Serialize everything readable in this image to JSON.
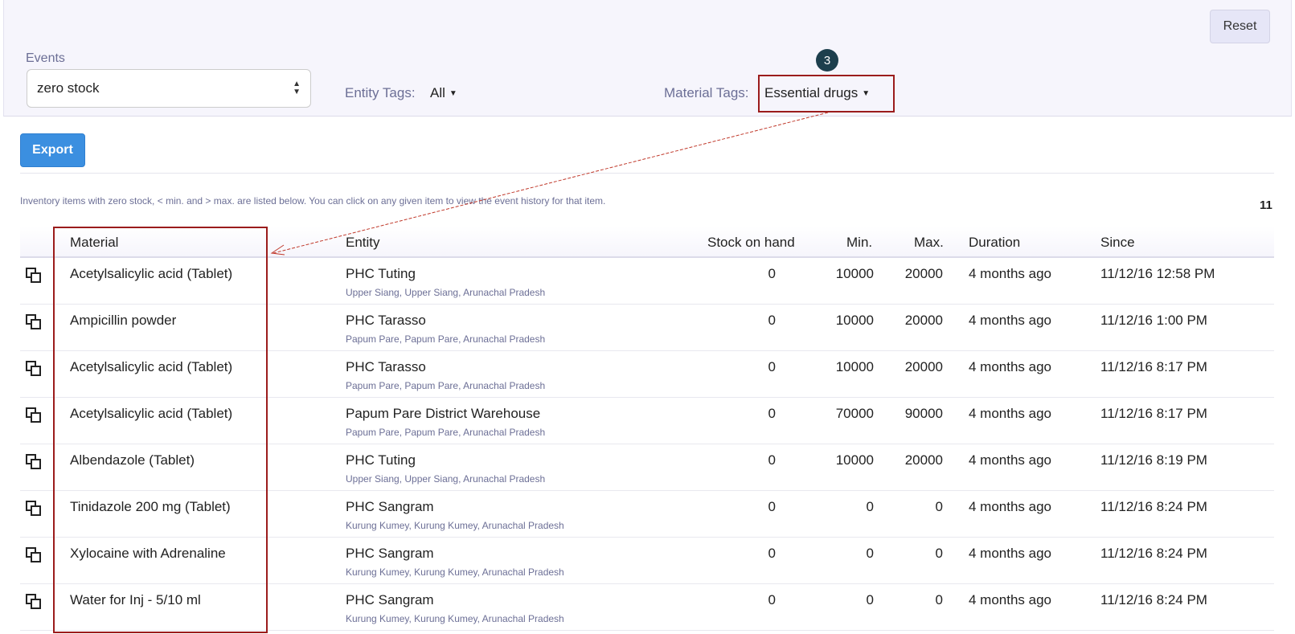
{
  "toolbar": {
    "reset_label": "Reset",
    "export_label": "Export"
  },
  "filters": {
    "events_label": "Events",
    "events_value": "zero stock",
    "entity_tags_label": "Entity Tags:",
    "entity_tags_value": "All",
    "material_tags_label": "Material Tags:",
    "material_tags_value": "Essential drugs"
  },
  "annotation": {
    "step_number": "3",
    "highlight_color": "#9b1c1c",
    "badge_color": "#1d3f4d"
  },
  "info_text": "Inventory items with zero stock, < min. and > max. are listed below. You can click on any given item to view the event history for that item.",
  "total_count": "11",
  "table": {
    "headers": {
      "material": "Material",
      "entity": "Entity",
      "stock": "Stock on hand",
      "min": "Min.",
      "max": "Max.",
      "duration": "Duration",
      "since": "Since"
    },
    "rows": [
      {
        "material": "Acetylsalicylic acid (Tablet)",
        "entity": "PHC Tuting",
        "location": "Upper Siang, Upper Siang, Arunachal Pradesh",
        "stock": "0",
        "min": "10000",
        "max": "20000",
        "duration": "4 months ago",
        "since": "11/12/16 12:58 PM"
      },
      {
        "material": "Ampicillin powder",
        "entity": "PHC Tarasso",
        "location": "Papum Pare, Papum Pare, Arunachal Pradesh",
        "stock": "0",
        "min": "10000",
        "max": "20000",
        "duration": "4 months ago",
        "since": "11/12/16 1:00 PM"
      },
      {
        "material": "Acetylsalicylic acid (Tablet)",
        "entity": "PHC Tarasso",
        "location": "Papum Pare, Papum Pare, Arunachal Pradesh",
        "stock": "0",
        "min": "10000",
        "max": "20000",
        "duration": "4 months ago",
        "since": "11/12/16 8:17 PM"
      },
      {
        "material": "Acetylsalicylic acid (Tablet)",
        "entity": "Papum Pare District Warehouse",
        "location": "Papum Pare, Papum Pare, Arunachal Pradesh",
        "stock": "0",
        "min": "70000",
        "max": "90000",
        "duration": "4 months ago",
        "since": "11/12/16 8:17 PM"
      },
      {
        "material": "Albendazole (Tablet)",
        "entity": "PHC Tuting",
        "location": "Upper Siang, Upper Siang, Arunachal Pradesh",
        "stock": "0",
        "min": "10000",
        "max": "20000",
        "duration": "4 months ago",
        "since": "11/12/16 8:19 PM"
      },
      {
        "material": "Tinidazole 200 mg (Tablet)",
        "entity": "PHC Sangram",
        "location": "Kurung Kumey, Kurung Kumey, Arunachal Pradesh",
        "stock": "0",
        "min": "0",
        "max": "0",
        "duration": "4 months ago",
        "since": "11/12/16 8:24 PM"
      },
      {
        "material": "Xylocaine with Adrenaline",
        "entity": "PHC Sangram",
        "location": "Kurung Kumey, Kurung Kumey, Arunachal Pradesh",
        "stock": "0",
        "min": "0",
        "max": "0",
        "duration": "4 months ago",
        "since": "11/12/16 8:24 PM"
      },
      {
        "material": "Water for Inj - 5/10 ml",
        "entity": "PHC Sangram",
        "location": "Kurung Kumey, Kurung Kumey, Arunachal Pradesh",
        "stock": "0",
        "min": "0",
        "max": "0",
        "duration": "4 months ago",
        "since": "11/12/16 8:24 PM"
      }
    ]
  },
  "icons": {
    "row_action": "copy-icon",
    "select_arrows": "select-arrows-icon",
    "dropdown": "caret-down-icon"
  }
}
